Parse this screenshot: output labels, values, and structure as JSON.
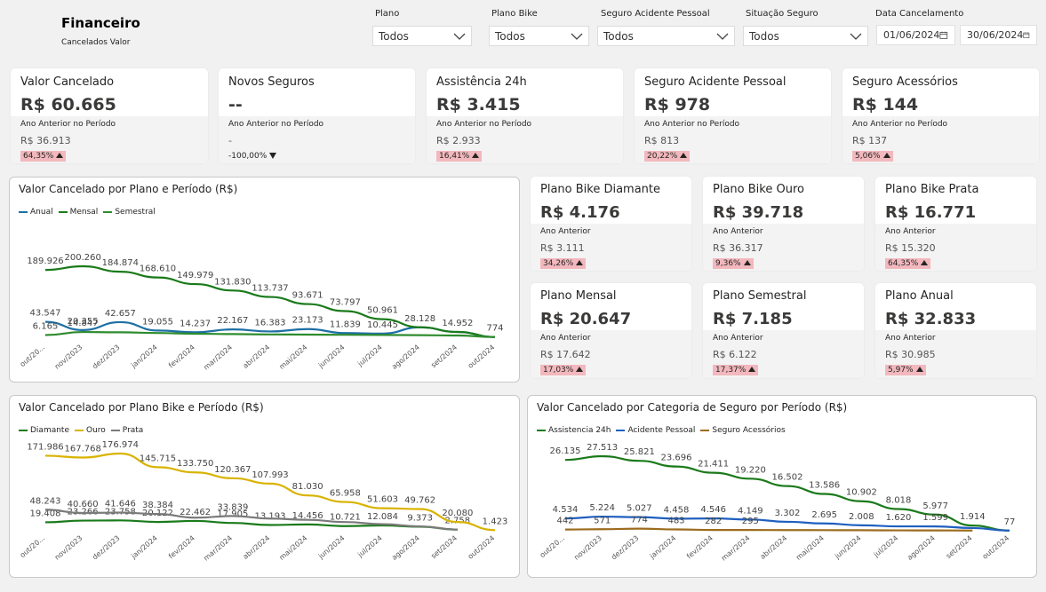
{
  "header": {
    "title": "Financeiro",
    "subtitle": "Cancelados Valor"
  },
  "filters": [
    {
      "label": "Plano",
      "value": "Todos"
    },
    {
      "label": "Plano Bike",
      "value": "Todos"
    },
    {
      "label": "Seguro Acidente Pessoal",
      "value": "Todos"
    },
    {
      "label": "Situação Seguro",
      "value": "Todos"
    }
  ],
  "date_filter": {
    "label": "Data Cancelamento",
    "start": "01/06/2024",
    "end": "30/06/2024"
  },
  "kpi_cards": [
    {
      "title": "Valor Cancelado",
      "value": "R$ 60.665",
      "sub_label": "Ano Anterior no Período",
      "prev": "R$ 36.913",
      "delta": "64,35%",
      "direction": "up"
    },
    {
      "title": "Novos Seguros",
      "value": "--",
      "sub_label": "Ano Anterior no Período",
      "prev": "-",
      "delta": "-100,00%",
      "direction": "down"
    },
    {
      "title": "Assistência 24h",
      "value": "R$ 3.415",
      "sub_label": "Ano Anterior no Período",
      "prev": "R$ 2.933",
      "delta": "16,41%",
      "direction": "up"
    },
    {
      "title": "Seguro Acidente Pessoal",
      "value": "R$ 978",
      "sub_label": "Ano Anterior no Período",
      "prev": "R$ 813",
      "delta": "20,22%",
      "direction": "up"
    },
    {
      "title": "Seguro Acessórios",
      "value": "R$ 144",
      "sub_label": "Ano Anterior no Período",
      "prev": "R$ 137",
      "delta": "5,06%",
      "direction": "up"
    }
  ],
  "plan_cards": [
    {
      "title": "Plano Bike Diamante",
      "value": "R$ 4.176",
      "sub_label": "Ano Anterior",
      "prev": "R$ 3.111",
      "delta": "34,26%"
    },
    {
      "title": "Plano Bike Ouro",
      "value": "R$ 39.718",
      "sub_label": "Ano Anterior",
      "prev": "R$ 36.317",
      "delta": "9,36%"
    },
    {
      "title": "Plano Bike Prata",
      "value": "R$ 16.771",
      "sub_label": "Ano Anterior",
      "prev": "R$ 15.320",
      "delta": "64,35%"
    },
    {
      "title": "Plano Mensal",
      "value": "R$ 20.647",
      "sub_label": "Ano Anterior",
      "prev": "R$ 17.642",
      "delta": "17,03%"
    },
    {
      "title": "Plano Semestral",
      "value": "R$ 7.185",
      "sub_label": "Ano Anterior",
      "prev": "R$ 6.122",
      "delta": "17,37%"
    },
    {
      "title": "Plano Anual",
      "value": "R$ 32.833",
      "sub_label": "Ano Anterior",
      "prev": "R$ 30.985",
      "delta": "5,97%"
    }
  ],
  "colors": {
    "green": "#1a7a1a",
    "blue": "#1f5fbf",
    "teal_blue": "#1d6fa5",
    "yellow": "#d9b300",
    "gray": "#7a7a7a",
    "brown": "#9c6b1d",
    "pill": "#f2b8bd"
  },
  "chart_data": [
    {
      "type": "line",
      "title": "Valor Cancelado por Plano e Período (R$)",
      "categories": [
        "out/2023",
        "nov/2023",
        "dez/2023",
        "jan/2024",
        "fev/2024",
        "mar/2024",
        "abr/2024",
        "mai/2024",
        "jun/2024",
        "jul/2024",
        "ago/2024",
        "set/2024",
        "out/2024"
      ],
      "tick_labels": [
        "out/20...",
        "nov/2023",
        "dez/2023",
        "jan/2024",
        "fev/2024",
        "mar/2024",
        "abr/2024",
        "mai/2024",
        "jun/2024",
        "jul/2024",
        "ago/2024",
        "set/2024",
        "out/2024"
      ],
      "series": [
        {
          "name": "Anual",
          "color": "#1d6fa5",
          "values": [
            43547,
            20355,
            42657,
            19055,
            14237,
            22167,
            16383,
            23173,
            11839,
            10445,
            28128,
            14952,
            774
          ],
          "labels": [
            "43.547",
            "20.355",
            "42.657",
            "19.055",
            "14.237",
            "22.167",
            "16.383",
            "23.173",
            "11.839",
            "10.445",
            "28.128",
            "14.952",
            "774"
          ]
        },
        {
          "name": "Mensal",
          "color": "#1a7a1a",
          "values": [
            189926,
            200260,
            184874,
            168610,
            149979,
            131830,
            113737,
            93671,
            73797,
            50961,
            28128,
            14952,
            774
          ],
          "labels": [
            "189.926",
            "200.260",
            "184.874",
            "168.610",
            "149.979",
            "131.830",
            "113.737",
            "93.671",
            "73.797",
            "50.961",
            "",
            "",
            ""
          ]
        },
        {
          "name": "Semestral",
          "color": "#2e8b2e",
          "values": [
            6165,
            14847,
            14000,
            12000,
            10000,
            9000,
            8000,
            7500,
            7000,
            6500,
            6000,
            5000,
            774
          ],
          "labels": [
            "6.165",
            "14.847",
            "",
            "",
            "",
            "",
            "",
            "",
            "",
            "",
            "",
            "",
            ""
          ]
        }
      ]
    },
    {
      "type": "line",
      "title": "Valor Cancelado por Plano Bike e Período (R$)",
      "categories": [
        "out/2023",
        "nov/2023",
        "dez/2023",
        "jan/2024",
        "fev/2024",
        "mar/2024",
        "abr/2024",
        "mai/2024",
        "jun/2024",
        "jul/2024",
        "ago/2024",
        "set/2024",
        "out/2024"
      ],
      "tick_labels": [
        "out/20...",
        "nov/2023",
        "dez/2023",
        "jan/2024",
        "fev/2024",
        "mar/2024",
        "abr/2024",
        "mai/2024",
        "jun/2024",
        "jul/2024",
        "ago/2024",
        "set/2024",
        "out/2024"
      ],
      "series": [
        {
          "name": "Diamante",
          "color": "#1a7a1a",
          "values": [
            19408,
            23266,
            23758,
            20122,
            22462,
            17905,
            13193,
            14456,
            10721,
            12084,
            9373,
            2758,
            null
          ],
          "labels": [
            "19.408",
            "23.266",
            "23.758",
            "20.122",
            "22.462",
            "17.905",
            "13.193",
            "14.456",
            "10.721",
            "12.084",
            "9.373",
            "2.758",
            ""
          ]
        },
        {
          "name": "Ouro",
          "color": "#d9b300",
          "values": [
            171986,
            167768,
            176974,
            145715,
            133750,
            120367,
            107993,
            81030,
            65958,
            51603,
            49762,
            20080,
            1423
          ],
          "labels": [
            "171.986",
            "167.768",
            "176.974",
            "145.715",
            "133.750",
            "120.367",
            "107.993",
            "81.030",
            "65.958",
            "51.603",
            "49.762",
            "20.080",
            "1.423"
          ]
        },
        {
          "name": "Prata",
          "color": "#7a7a7a",
          "values": [
            48243,
            40660,
            41646,
            38384,
            30000,
            33839,
            28000,
            25000,
            20000,
            15000,
            10000,
            2758,
            null
          ],
          "labels": [
            "48.243",
            "40.660",
            "41.646",
            "38.384",
            "",
            "33.839",
            "",
            "",
            "",
            "",
            "",
            "",
            ""
          ]
        }
      ]
    },
    {
      "type": "line",
      "title": "Valor Cancelado por Categoria de Seguro por Período (R$)",
      "categories": [
        "out/2023",
        "nov/2023",
        "dez/2023",
        "jan/2024",
        "fev/2024",
        "mar/2024",
        "abr/2024",
        "mai/2024",
        "jun/2024",
        "jul/2024",
        "ago/2024",
        "set/2024",
        "out/2024"
      ],
      "tick_labels": [
        "out/20...",
        "nov/2023",
        "dez/2023",
        "jan/2024",
        "fev/2024",
        "mar/2024",
        "abr/2024",
        "mai/2024",
        "jun/2024",
        "jul/2024",
        "ago/2024",
        "set/2024",
        "out/2024"
      ],
      "series": [
        {
          "name": "Assistencia 24h",
          "color": "#1a7a1a",
          "values": [
            26135,
            27513,
            25821,
            23696,
            21411,
            19220,
            16502,
            13586,
            10902,
            8018,
            5977,
            1914,
            77
          ],
          "labels": [
            "26.135",
            "27.513",
            "25.821",
            "23.696",
            "21.411",
            "19.220",
            "16.502",
            "13.586",
            "10.902",
            "8.018",
            "5.977",
            "1.914",
            "77"
          ]
        },
        {
          "name": "Acidente Pessoal",
          "color": "#1f5fbf",
          "values": [
            4534,
            5224,
            5027,
            4458,
            4546,
            4149,
            3302,
            2695,
            2008,
            1620,
            1599,
            1000,
            77
          ],
          "labels": [
            "4.534",
            "5.224",
            "5.027",
            "4.458",
            "4.546",
            "4.149",
            "3.302",
            "2.695",
            "2.008",
            "1.620",
            "1.599",
            "",
            ""
          ]
        },
        {
          "name": "Seguro Acessórios",
          "color": "#9c6b1d",
          "values": [
            442,
            571,
            774,
            483,
            282,
            295,
            250,
            230,
            200,
            150,
            120,
            80,
            null
          ],
          "labels": [
            "442",
            "571",
            "774",
            "483",
            "282",
            "295",
            "",
            "",
            "",
            "",
            "",
            "",
            ""
          ]
        }
      ]
    }
  ]
}
